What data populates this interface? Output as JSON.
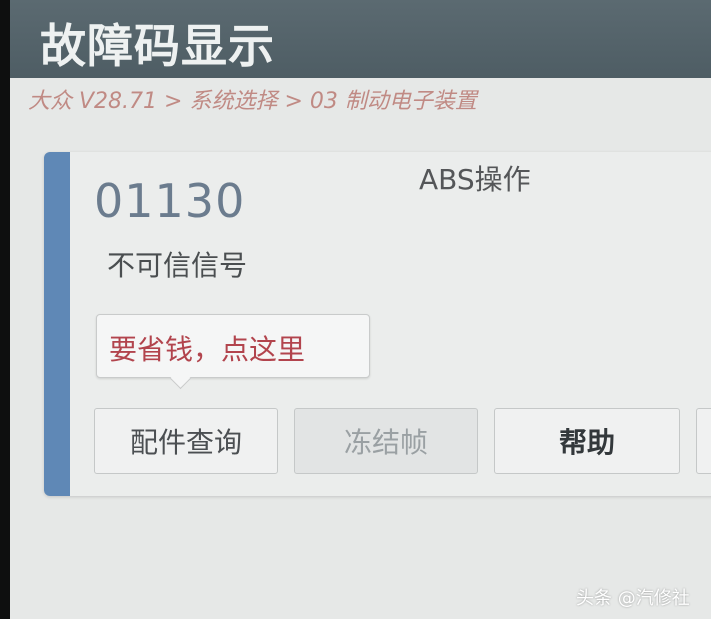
{
  "window": {
    "title": "故障码显示"
  },
  "breadcrumb": "大众 V28.71 > 系统选择 > 03 制动电子装置",
  "fault": {
    "code": "01130",
    "description": "不可信信号",
    "status": "ABS操作"
  },
  "promo": {
    "text": "要省钱，点这里"
  },
  "buttons": {
    "parts": "配件查询",
    "freeze": "冻结帧",
    "help": "帮助",
    "more": ""
  },
  "watermark": "头条 @汽修社",
  "colors": {
    "titlebar": "#56656c",
    "accent_bar": "#5f88b6",
    "breadcrumb": "#c08a84",
    "promo_text": "#b2444d",
    "fault_code": "#6b7c8e"
  }
}
